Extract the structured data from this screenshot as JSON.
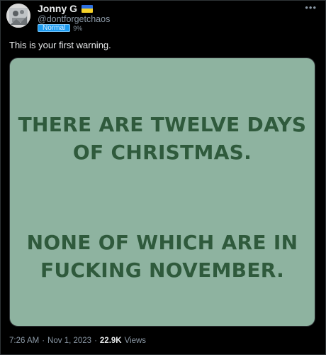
{
  "author": {
    "display_name": "Jonny G",
    "handle": "@dontforgetchaos",
    "badge_label": "Normal",
    "badge_value": "9%",
    "avatar_icon": "avatar-photo",
    "flag_icon": "ukraine-flag-icon"
  },
  "tweet": {
    "text": "This is your first warning.",
    "more_icon": "•••"
  },
  "media": {
    "background_color": "#8eb3a0",
    "text_color": "#2f5a3c",
    "lines": [
      "THERE ARE TWELVE DAYS",
      "OF CHRISTMAS.",
      "NONE OF WHICH ARE IN",
      "FUCKING NOVEMBER."
    ]
  },
  "meta": {
    "time": "7:26 AM",
    "separator": "·",
    "date": "Nov 1, 2023",
    "views_count": "22.9K",
    "views_label": "Views"
  }
}
